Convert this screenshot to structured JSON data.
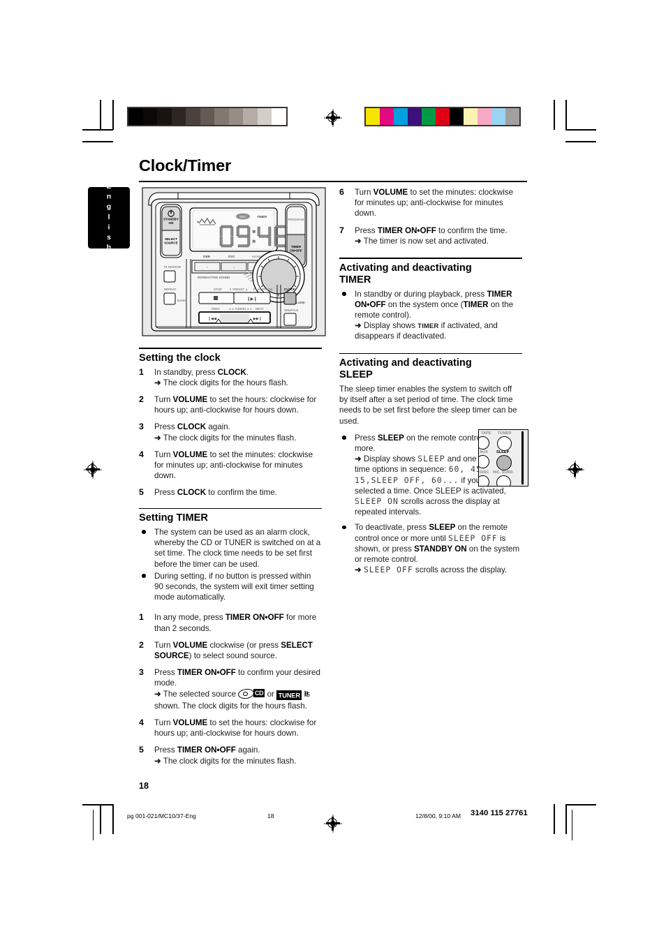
{
  "page": {
    "title": "Clock/Timer",
    "language_tab": "English",
    "page_number": "18"
  },
  "print_marks": {
    "grayscale_swatches": [
      "#000000",
      "#0b0908",
      "#191310",
      "#2e2622",
      "#4b423d",
      "#635a54",
      "#807871",
      "#958d86",
      "#b4aca5",
      "#d4cec8",
      "#ffffff"
    ],
    "color_swatches": [
      "#f5e400",
      "#e3097e",
      "#00a0e0",
      "#3a1178",
      "#009a46",
      "#e00016",
      "#000000",
      "#fbf2b3",
      "#f7a8c4",
      "#9bd4f2",
      "#a0a0a0"
    ]
  },
  "device": {
    "display_time": "09:48",
    "display_timer_indicator": "TIMER",
    "buttons": {
      "standby": "STANDBY\nON",
      "select_source": "SELECT\nSOURCE",
      "program": "PROGRAM",
      "timer_onoff": "TIMER\nON•OFF",
      "ir_sensor": "IR SENSOR",
      "repeat": "REPEAT",
      "band": "BAND",
      "clock": "CLOCK",
      "shuffle": "SHUFFLE",
      "volume": "VOLUME",
      "stop": "STOP",
      "preset": "▼ PRESET ▲",
      "play_pause": "PLAY•PAUSE",
      "prev": "PREV",
      "tuning": "◄◄ TUNING ►►",
      "next": "NEXT",
      "dbb": "DBB",
      "dsc": "DSC",
      "incredible_surr": "INCREDIBLE SURR.",
      "interactive_sound": "INTERACTIVE SOUND"
    }
  },
  "left_column": {
    "setting_clock": {
      "heading": "Setting the clock",
      "steps": [
        {
          "n": "1",
          "text": "In standby, press ",
          "bold": "CLOCK",
          "tail": ".",
          "arrow": "The clock digits for the hours flash."
        },
        {
          "n": "2",
          "text": "Turn ",
          "bold": "VOLUME",
          "tail": " to set the hours: clockwise for hours up; anti-clockwise for hours down.",
          "arrow": ""
        },
        {
          "n": "3",
          "text": "Press ",
          "bold": "CLOCK",
          "tail": " again.",
          "arrow": "The clock digits for the minutes flash."
        },
        {
          "n": "4",
          "text": "Turn ",
          "bold": "VOLUME",
          "tail": " to set the minutes: clockwise for minutes up; anti-clockwise for minutes down.",
          "arrow": ""
        },
        {
          "n": "5",
          "text": "Press ",
          "bold": "CLOCK",
          "tail": " to confirm the time.",
          "arrow": ""
        }
      ]
    },
    "setting_timer": {
      "heading": "Setting TIMER",
      "bullets": [
        "The system can be used as an alarm clock, whereby the CD or TUNER is switched on at a set time. The clock time needs to be set first before the timer can be used.",
        "During setting, if no button is pressed within 90 seconds, the system will exit timer setting mode automatically."
      ],
      "steps": [
        {
          "n": "1",
          "text": "In any mode, press ",
          "bold": "TIMER ON•OFF",
          "tail": " for more than 2 seconds.",
          "arrow": ""
        },
        {
          "n": "2",
          "text": "Turn ",
          "bold": "VOLUME",
          "tail": " clockwise (or press ",
          "bold2": "SELECT SOURCE",
          "tail2": ") to select sound source.",
          "arrow": ""
        },
        {
          "n": "3",
          "text": "Press ",
          "bold": "TIMER ON•OFF",
          "tail": " to confirm your desired mode.",
          "arrow_pre": "The selected source ",
          "arrow_mid": " or ",
          "arrow_post": " is shown.  The clock digits for the hours flash.",
          "cd_label": "CD",
          "tuner_label": "TUNER"
        },
        {
          "n": "4",
          "text": "Turn ",
          "bold": "VOLUME",
          "tail": " to set the hours: clockwise for hours up; anti-clockwise for hours down.",
          "arrow": ""
        },
        {
          "n": "5",
          "text": "Press ",
          "bold": "TIMER ON•OFF",
          "tail": " again.",
          "arrow": "The clock digits for the minutes flash."
        }
      ]
    }
  },
  "right_column": {
    "continued_steps": [
      {
        "n": "6",
        "text": "Turn ",
        "bold": "VOLUME",
        "tail": " to set the minutes: clockwise for minutes up; anti-clockwise for minutes down.",
        "arrow": ""
      },
      {
        "n": "7",
        "text": "Press ",
        "bold": "TIMER ON•OFF",
        "tail": " to confirm the time.",
        "arrow": "The timer is now set and activated."
      }
    ],
    "activating_timer": {
      "heading_line1": "Activating and deactivating",
      "heading_line2": "TIMER",
      "bullet_pre": "In standby or during playback, press ",
      "bullet_bold1": "TIMER ON•OFF",
      "bullet_mid": " on the system once (",
      "bullet_bold2": "TIMER",
      "bullet_post": " on the remote control).",
      "arrow_pre": "Display shows ",
      "arrow_sc": "TIMER",
      "arrow_post": " if activated, and disappears if deactivated."
    },
    "activating_sleep": {
      "heading_line1": "Activating and deactivating",
      "heading_line2": "SLEEP",
      "intro": "The sleep timer enables the system to switch off by itself after a set period of time. The clock time needs to be set first before the sleep timer can be used.",
      "bullet1_pre": "Press ",
      "bullet1_bold": "SLEEP",
      "bullet1_post": " on the remote control once or more.",
      "arrow1_pre": "Display shows ",
      "arrow1_lcd1": "SLEEP",
      "arrow1_mid": " and one of the sleep time options in sequence: ",
      "arrow1_lcd2": "60, 45, 30, 15,",
      "arrow1_lcd3": "SLEEP OFF",
      "arrow1_lcd4": ", 60...",
      "arrow1_post": " if you have selected a time. Once SLEEP is activated, ",
      "arrow1_lcd5": "SLEEP ON",
      "arrow1_end": " scrolls across the display at repeated intervals.",
      "bullet2_pre": "To deactivate, press ",
      "bullet2_bold1": "SLEEP",
      "bullet2_mid1": " on the remote control once or more until ",
      "bullet2_lcd1": "SLEEP OFF",
      "bullet2_mid2": " is shown, or press ",
      "bullet2_bold2": "STANDBY ON",
      "bullet2_post": " on the system or remote control.",
      "arrow2_lcd": "SLEEP OFF",
      "arrow2_post": " scrolls across the display."
    },
    "remote_inset": {
      "sleep_label": "SLEEP",
      "tuner_label": "TUNER",
      "inc_surr_label": "INC. SURR.",
      "aux_label": "AUX",
      "disc_label": "DISC",
      "tape_label": "TAPE"
    }
  },
  "footer": {
    "file": "pg 001-021/MC10/37-Eng",
    "page": "18",
    "timestamp": "12/8/00, 9:10 AM",
    "doc_id": "3140 115 27761"
  }
}
